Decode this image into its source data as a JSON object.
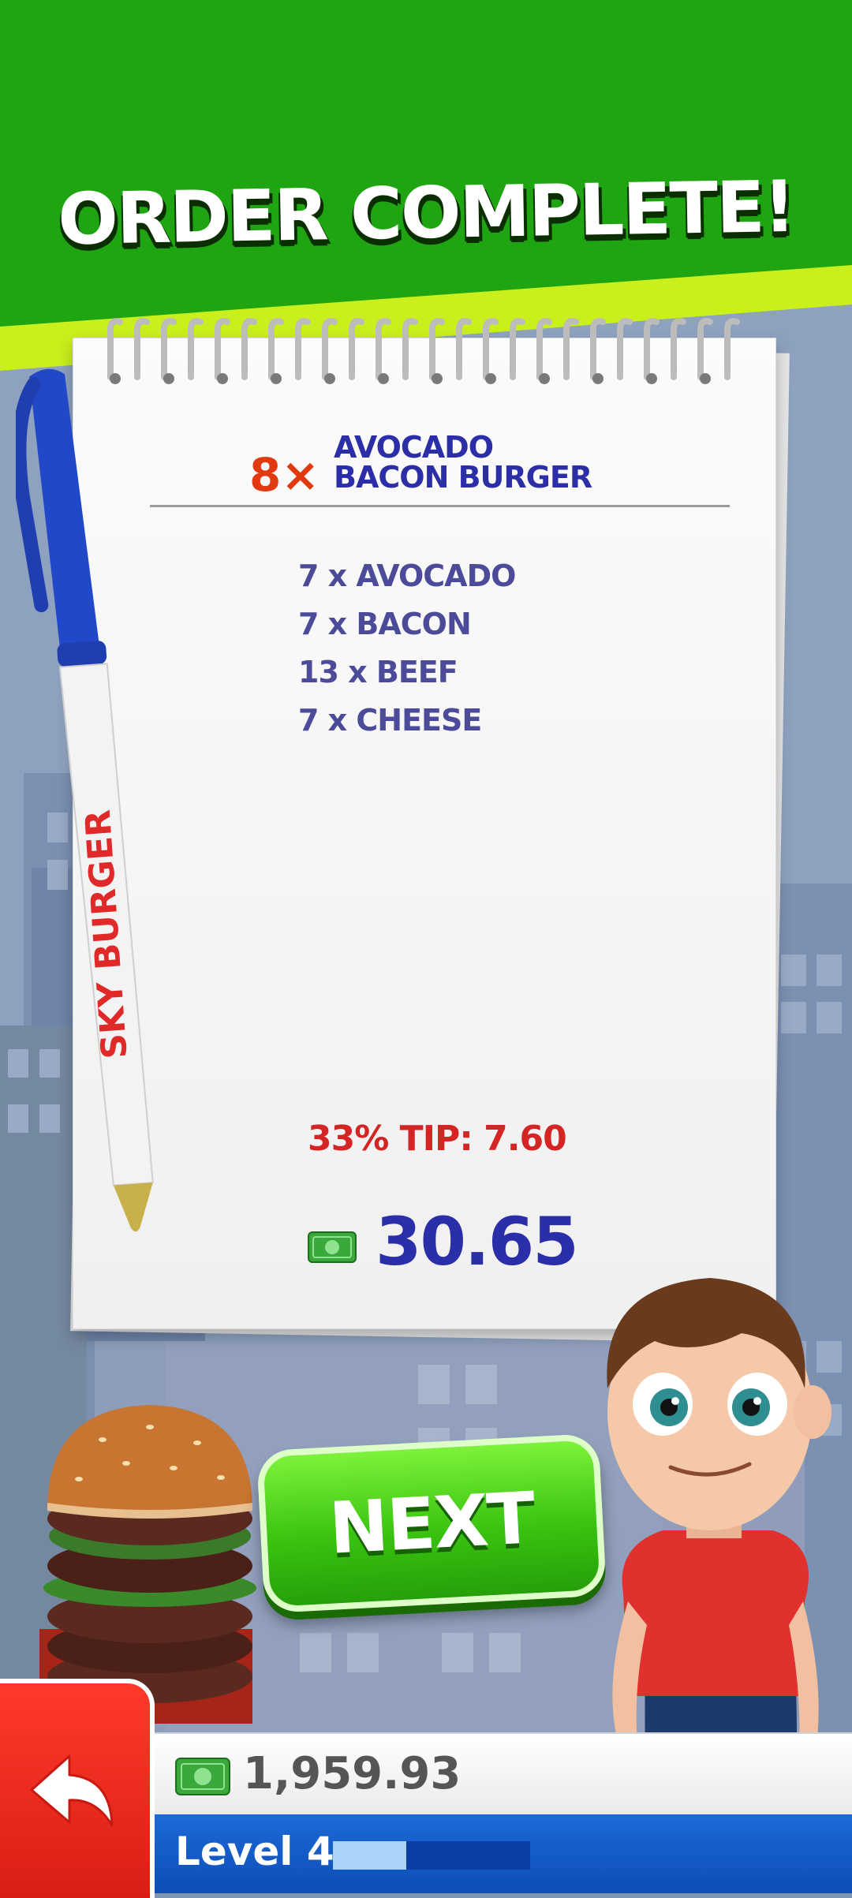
{
  "header": {
    "title": "ORDER COMPLETE!"
  },
  "order": {
    "quantity": "8×",
    "burger_line1": "AVOCADO",
    "burger_line2": "BACON BURGER",
    "ingredients": [
      "7 x AVOCADO",
      "7 x BACON",
      "13 x BEEF",
      "7 x CHEESE"
    ],
    "tip": "33% TIP: 7.60",
    "total": "30.65"
  },
  "pen": {
    "brand": "SKY BURGER"
  },
  "actions": {
    "next_label": "NEXT"
  },
  "footer": {
    "money": "1,959.93",
    "level_label": "Level 4",
    "level_progress": 0.37
  },
  "colors": {
    "banner_green": "#1fa512",
    "banner_lime": "#c8f01a",
    "ink_blue": "#2b2ea6",
    "tip_red": "#d42424",
    "next_green": "#3ac410"
  },
  "icons": [
    "cash-icon",
    "back-arrow-icon",
    "pen-icon"
  ]
}
